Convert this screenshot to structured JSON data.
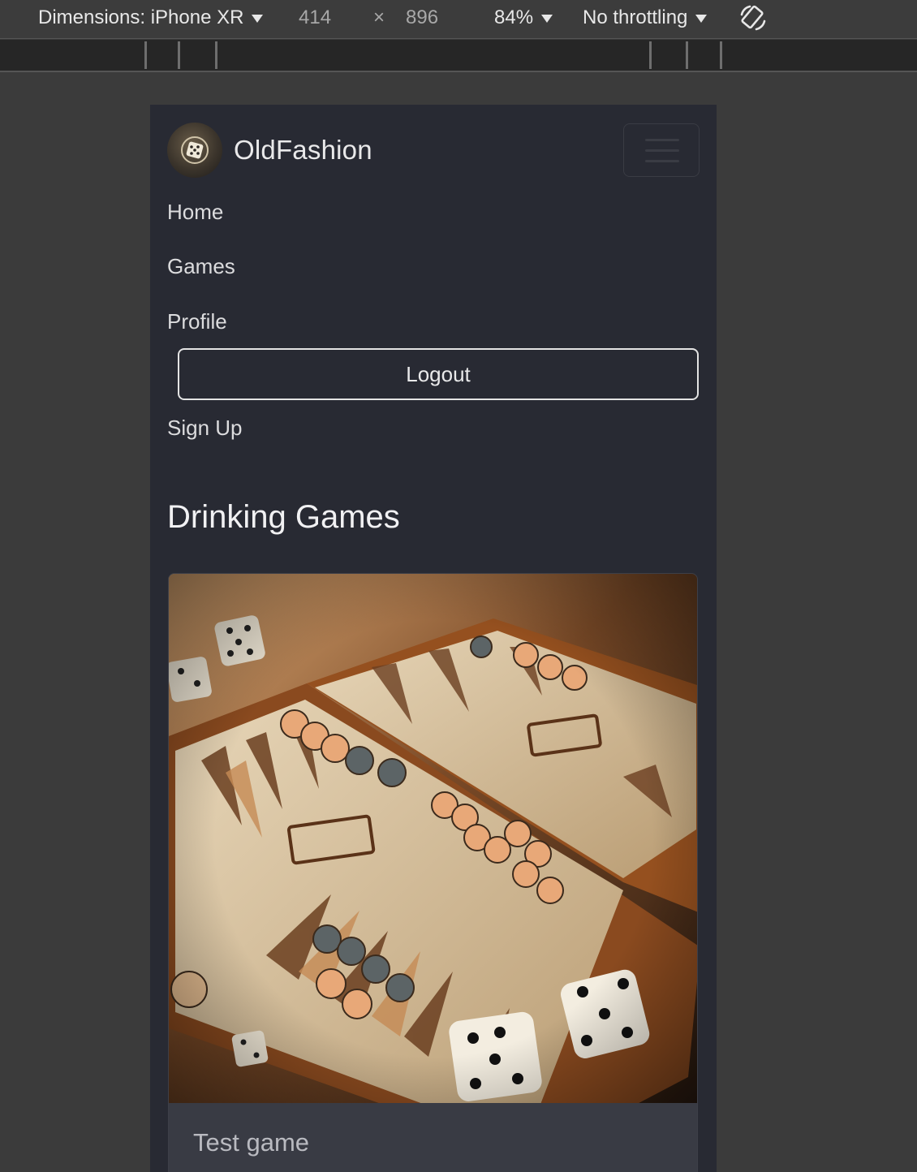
{
  "devtools": {
    "device_label": "Dimensions: iPhone XR",
    "width": "414",
    "times": "×",
    "height": "896",
    "zoom": "84%",
    "throttling": "No throttling",
    "rotate_icon": "rotate-icon"
  },
  "navbar": {
    "brand": "OldFashion",
    "logo_icon": "dice-logo-icon",
    "toggler_icon": "hamburger-icon",
    "links": [
      "Home",
      "Games",
      "Profile"
    ],
    "logout": "Logout",
    "signup": "Sign Up"
  },
  "main": {
    "section_title": "Drinking Games",
    "cards": [
      {
        "title": "Test game",
        "image": "backgammon-board-with-dice"
      }
    ]
  },
  "colors": {
    "page_bg": "#282a33",
    "devtools_bg": "#3c3c3c",
    "card_footer": "#393b44"
  }
}
